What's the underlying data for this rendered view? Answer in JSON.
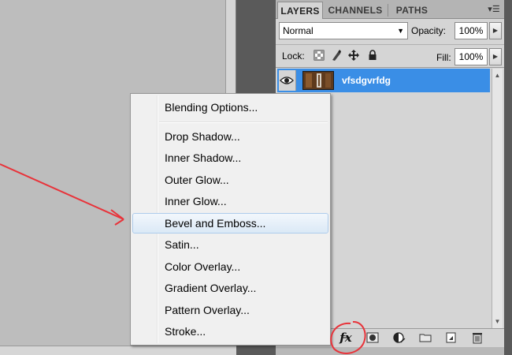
{
  "panel": {
    "tabs": [
      "LAYERS",
      "CHANNELS",
      "PATHS"
    ],
    "blend_mode": "Normal",
    "opacity_label": "Opacity:",
    "opacity_value": "100%",
    "lock_label": "Lock:",
    "fill_label": "Fill:",
    "fill_value": "100%",
    "layer": {
      "name": "vfsdgvrfdg"
    },
    "selected_color": "#3a8ee6"
  },
  "menu": {
    "items": [
      "Blending Options...",
      "Drop Shadow...",
      "Inner Shadow...",
      "Outer Glow...",
      "Inner Glow...",
      "Bevel and Emboss...",
      "Satin...",
      "Color Overlay...",
      "Gradient Overlay...",
      "Pattern Overlay...",
      "Stroke..."
    ],
    "highlighted": "Bevel and Emboss..."
  },
  "annotation": {
    "arrow_color": "#e8333a",
    "fx_label": "fx"
  }
}
